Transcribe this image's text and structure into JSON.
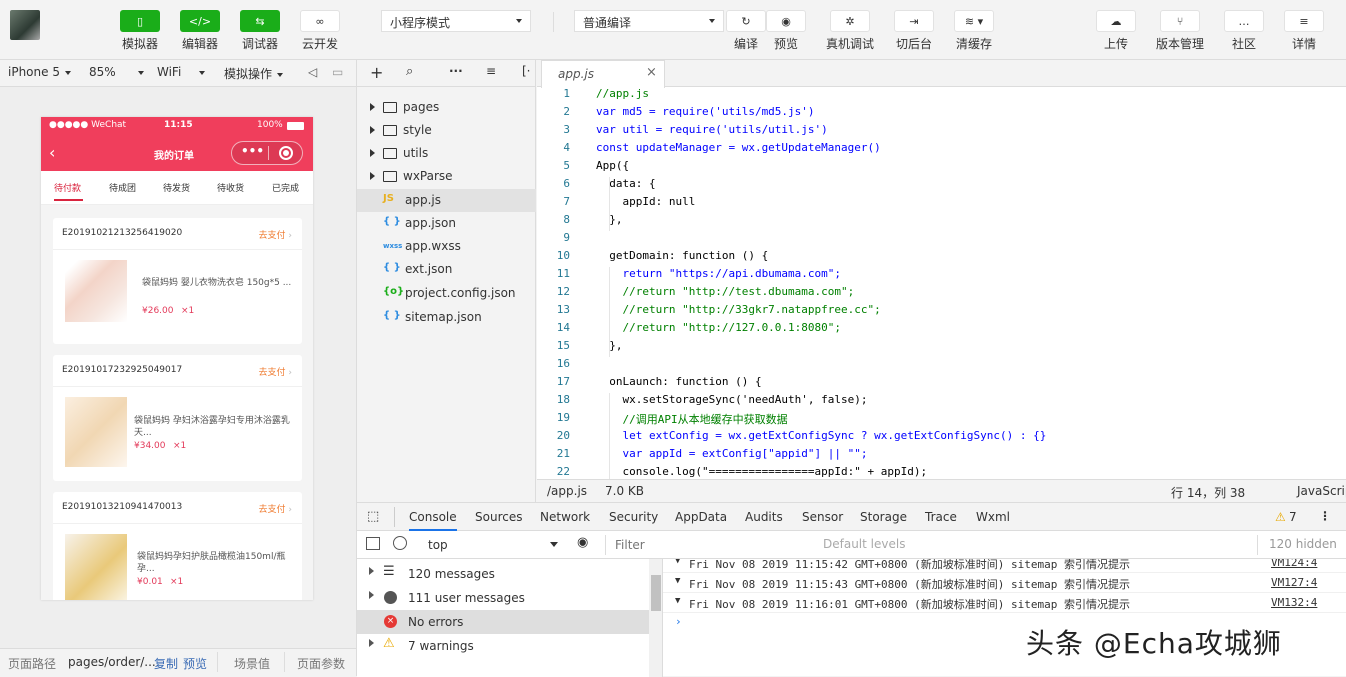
{
  "toolbar": {
    "simulator_label": "模拟器",
    "editor_label": "编辑器",
    "debugger_label": "调试器",
    "cloud_label": "云开发",
    "mode_select": "小程序模式",
    "compile_select": "普通编译",
    "compile_label": "编译",
    "preview_label": "预览",
    "remote_debug_label": "真机调试",
    "backend_label": "切后台",
    "clear_cache_label": "清缓存",
    "upload_label": "上传",
    "version_label": "版本管理",
    "community_label": "社区",
    "details_label": "详情"
  },
  "simbar": {
    "device": "iPhone 5",
    "zoom": "85%",
    "network": "WiFi",
    "simulate_ops": "模拟操作"
  },
  "phone": {
    "status_left": "●●●●● WeChat",
    "status_time": "11:15",
    "status_battery": "100%",
    "title": "我的订单",
    "tabs": [
      "待付款",
      "待成团",
      "待发货",
      "待收货",
      "已完成"
    ],
    "orders": [
      {
        "id": "E20191021213256419020",
        "action": "去支付",
        "name": "袋鼠妈妈 婴儿衣物洗衣皂 150g*5 ...",
        "price": "¥26.00",
        "qty": "×1"
      },
      {
        "id": "E20191017232925049017",
        "action": "去支付",
        "name": "袋鼠妈妈 孕妇沐浴露孕妇专用沐浴露乳 天...",
        "price": "¥34.00",
        "qty": "×1"
      },
      {
        "id": "E20191013210941470013",
        "action": "去支付",
        "name": "袋鼠妈妈孕妇护肤品橄榄油150ml/瓶 孕...",
        "price": "¥0.01",
        "qty": "×1"
      }
    ]
  },
  "bottombar": {
    "path_label": "页面路径",
    "path_value": "pages/order/...",
    "copy": "复制",
    "preview": "预览",
    "scene_label": "场景值",
    "params_label": "页面参数"
  },
  "filetree": {
    "items": [
      {
        "type": "folder",
        "name": "pages"
      },
      {
        "type": "folder",
        "name": "style"
      },
      {
        "type": "folder",
        "name": "utils"
      },
      {
        "type": "folder",
        "name": "wxParse"
      },
      {
        "type": "js",
        "icon": "JS",
        "name": "app.js"
      },
      {
        "type": "json",
        "icon": "{ }",
        "name": "app.json"
      },
      {
        "type": "wxss",
        "icon": "wxss",
        "name": "app.wxss"
      },
      {
        "type": "json",
        "icon": "{ }",
        "name": "ext.json"
      },
      {
        "type": "config",
        "icon": "{o}",
        "name": "project.config.json"
      },
      {
        "type": "json",
        "icon": "{ }",
        "name": "sitemap.json"
      }
    ]
  },
  "editor": {
    "tab_name": "app.js",
    "lines": [
      "//app.js",
      "var md5 = require('utils/md5.js')",
      "var util = require('utils/util.js')",
      "const updateManager = wx.getUpdateManager()",
      "App({",
      "  data: {",
      "    appId: null",
      "  },",
      "",
      "  getDomain: function () {",
      "    return \"https://api.dbumama.com\";",
      "    //return \"http://test.dbumama.com\";",
      "    //return \"http://33gkr7.natappfree.cc\";",
      "    //return \"http://127.0.0.1:8080\";",
      "  },",
      "",
      "  onLaunch: function () {",
      "    wx.setStorageSync('needAuth', false);",
      "    //调用API从本地缓存中获取数据",
      "    let extConfig = wx.getExtConfigSync ? wx.getExtConfigSync() : {}",
      "    var appId = extConfig[\"appid\"] || \"\";",
      "    console.log(\"================appId:\" + appId);"
    ],
    "status_path": "/app.js",
    "status_size": "7.0 KB",
    "status_pos": "行 14，列 38",
    "status_lang": "JavaScript"
  },
  "devtools": {
    "tabs": [
      "Console",
      "Sources",
      "Network",
      "Security",
      "AppData",
      "Audits",
      "Sensor",
      "Storage",
      "Trace",
      "Wxml"
    ],
    "warning_count": "7",
    "context": "top",
    "filter_placeholder": "Filter",
    "levels": "Default levels",
    "hidden": "120 hidden",
    "side": [
      {
        "icon": "list",
        "label": "120 messages"
      },
      {
        "icon": "user",
        "label": "111 user messages"
      },
      {
        "icon": "error",
        "label": "No errors"
      },
      {
        "icon": "warning",
        "label": "7 warnings"
      }
    ],
    "logs": [
      {
        "text": "Fri Nov 08 2019 11:15:42 GMT+0800 (新加坡标准时间) sitemap 索引情况提示",
        "src": "VM124:4"
      },
      {
        "text": "Fri Nov 08 2019 11:15:43 GMT+0800 (新加坡标准时间) sitemap 索引情况提示",
        "src": "VM127:4"
      },
      {
        "text": "Fri Nov 08 2019 11:16:01 GMT+0800 (新加坡标准时间) sitemap 索引情况提示",
        "src": "VM132:4"
      }
    ]
  },
  "watermark": "头条 @Echa攻城狮"
}
